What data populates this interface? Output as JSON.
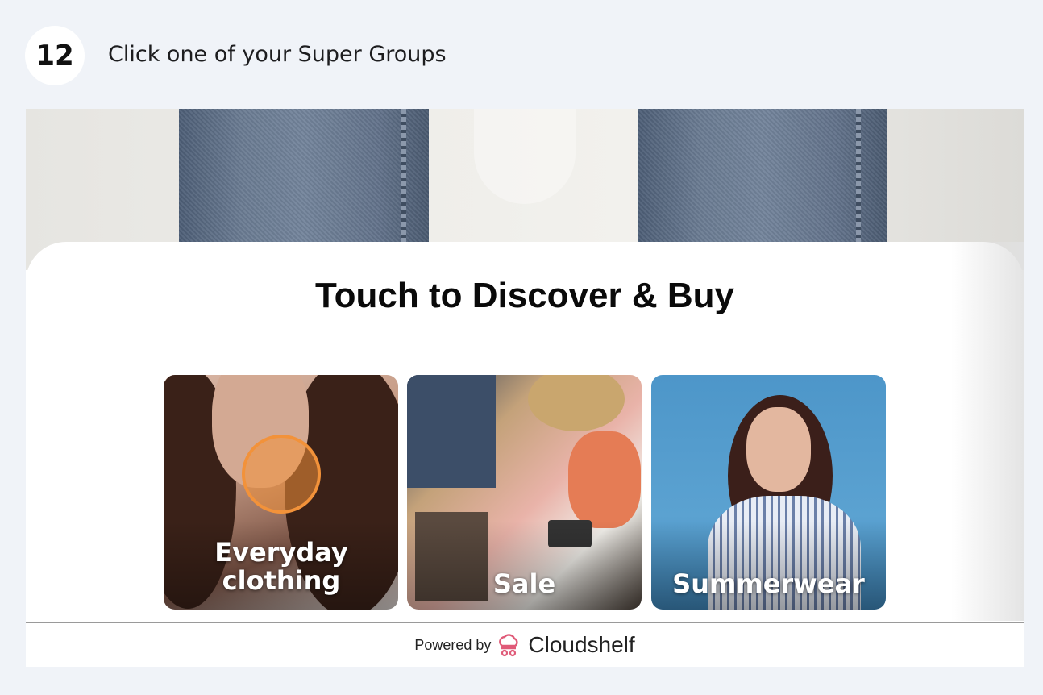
{
  "step": {
    "number": "12",
    "instruction": "Click one of your Super Groups"
  },
  "kiosk": {
    "heading": "Touch to Discover & Buy",
    "tiles": [
      {
        "label": "Everyday clothing"
      },
      {
        "label": "Sale"
      },
      {
        "label": "Summerwear"
      }
    ],
    "footer": {
      "powered_by": "Powered by",
      "brand": "Cloudshelf"
    }
  },
  "colors": {
    "click_highlight": "#f2923a",
    "brand_icon": "#e05a78"
  },
  "icons": {
    "brand": "cloudshelf-logo-icon"
  }
}
